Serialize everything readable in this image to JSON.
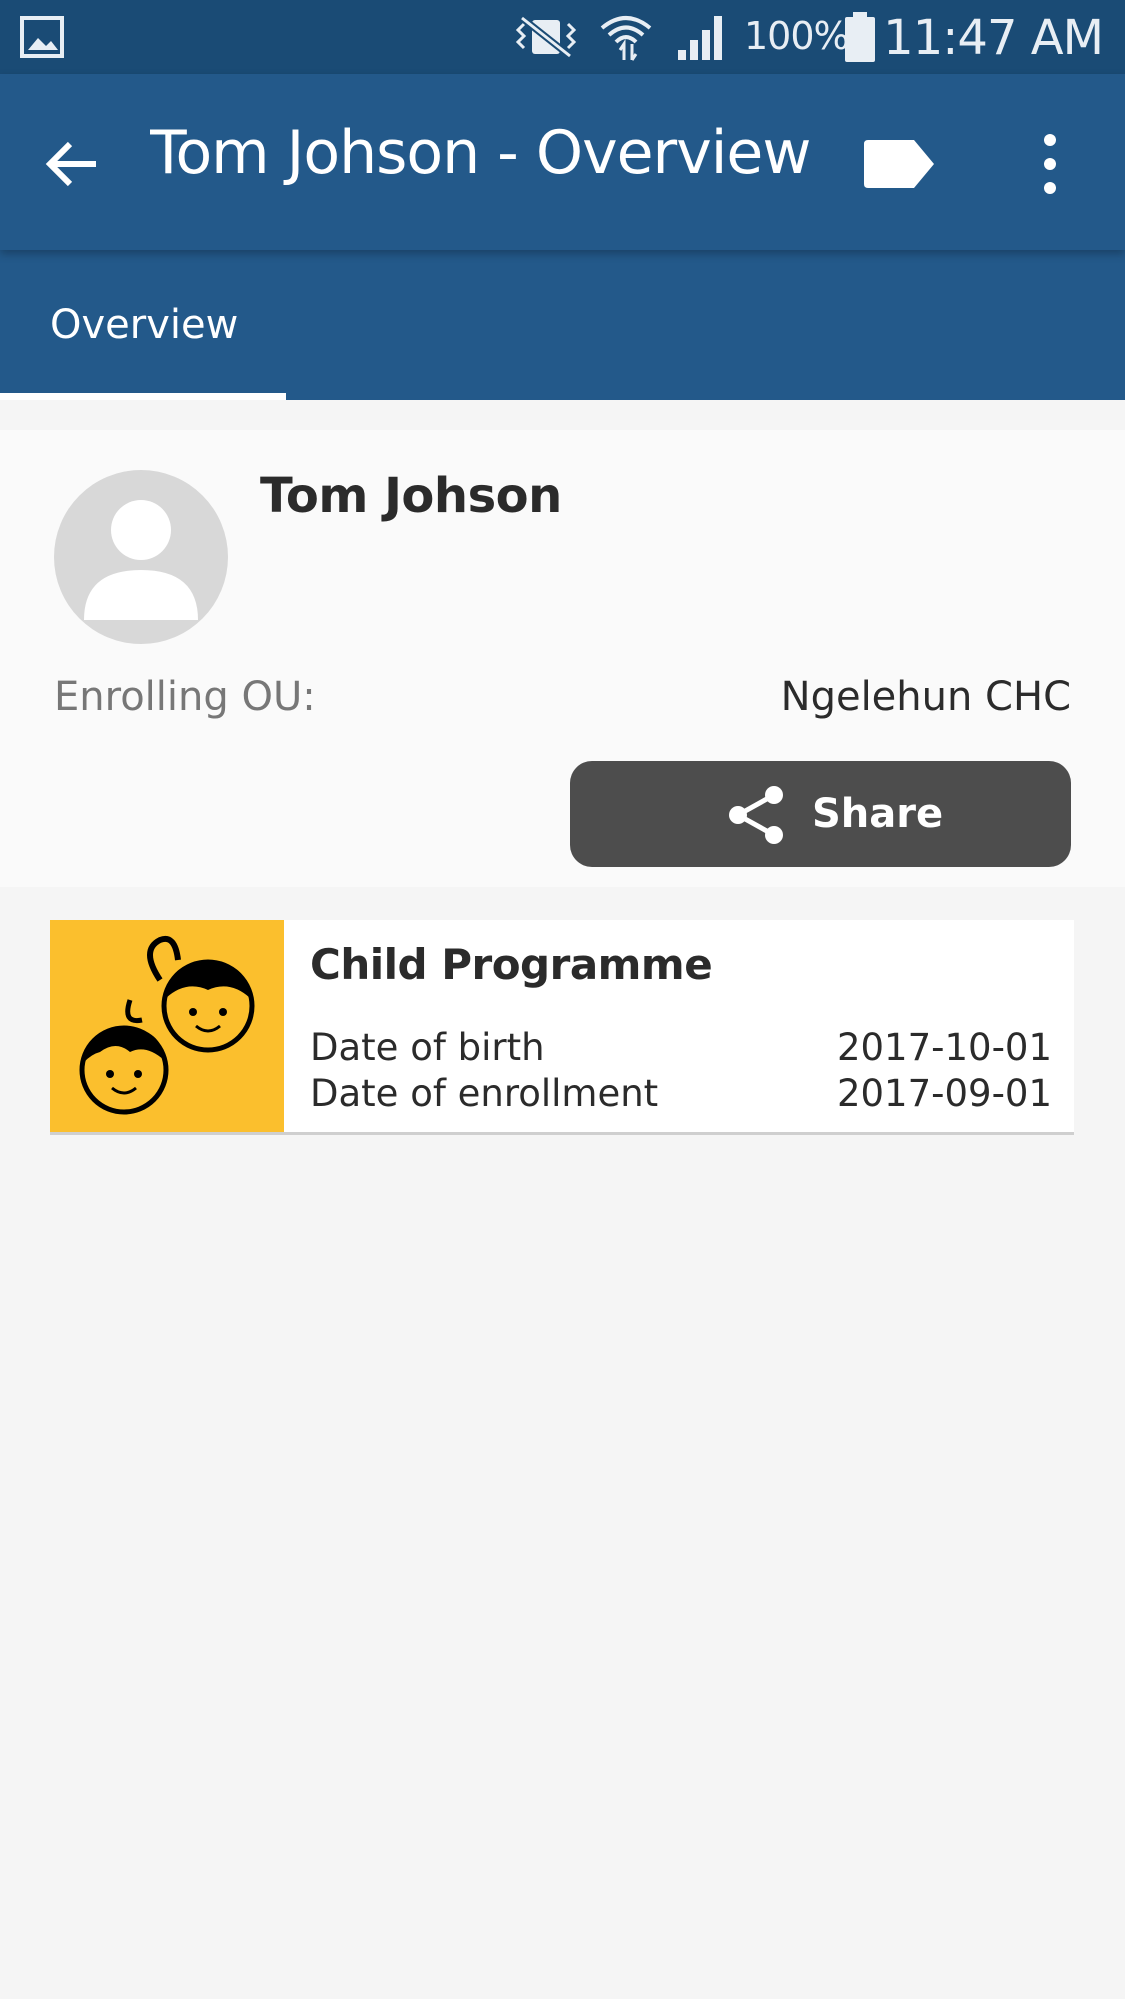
{
  "status_bar": {
    "battery_percent": "100%",
    "time": "11:47 AM",
    "icons": [
      "gallery-icon",
      "vibrate-icon",
      "wifi-icon",
      "signal-icon",
      "battery-icon"
    ]
  },
  "app_bar": {
    "title": "Tom Johson - Overview",
    "icons": [
      "back-arrow-icon",
      "label-tag-icon",
      "more-vert-icon"
    ]
  },
  "tabs": [
    {
      "label": "Overview",
      "selected": true
    }
  ],
  "profile": {
    "name": "Tom Johson",
    "enrolling_ou_label": "Enrolling OU:",
    "enrolling_ou_value": "Ngelehun CHC",
    "share_label": "Share"
  },
  "program": {
    "name": "Child Programme",
    "icon": "children-faces-icon",
    "icon_background": "#fbbf2d",
    "attributes": [
      {
        "label": "Date of birth",
        "value": "2017-10-01"
      },
      {
        "label": "Date of enrollment",
        "value": "2017-09-01"
      }
    ]
  },
  "colors": {
    "status_bar": "#1a4b75",
    "primary": "#23598a",
    "share_button": "#4d4d4d"
  }
}
